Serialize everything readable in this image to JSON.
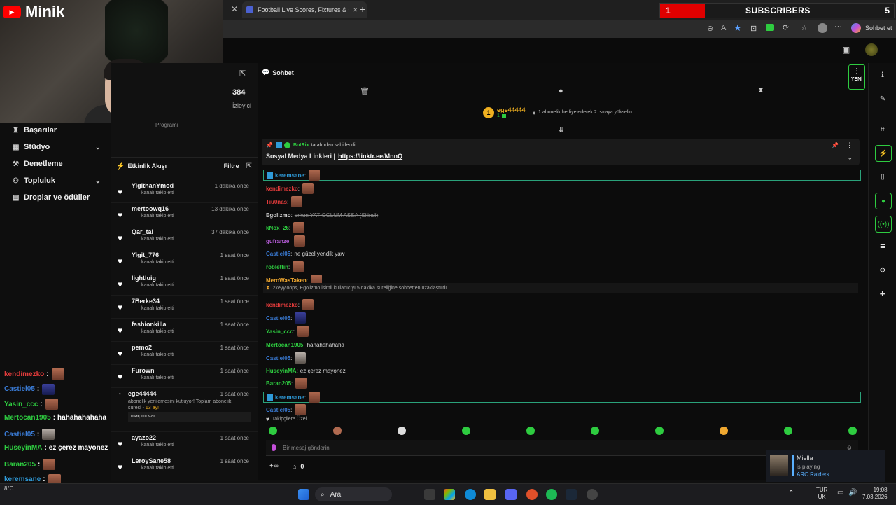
{
  "overlay_brand": "Minik",
  "browser": {
    "tab_title": "Football Live Scores, Fixtures & Od",
    "sidebar_label": "Sohbet et"
  },
  "subscribers": {
    "current": "1",
    "label": "SUBSCRIBERS",
    "goal": "5"
  },
  "leftnav": {
    "items": [
      {
        "label": "Başarılar"
      },
      {
        "label": "Stüdyo"
      },
      {
        "label": "Denetleme"
      },
      {
        "label": "Topluluk"
      },
      {
        "label": "Droplar ve ödüller"
      }
    ]
  },
  "stats": {
    "viewers": "384",
    "viewers_label": "İzleyici",
    "program_label": "Programı"
  },
  "activity": {
    "title": "Etkinlik Akışı",
    "filter": "Filtre",
    "items": [
      {
        "user": "YigithanYmod",
        "desc": "kanalı takip etti",
        "time": "1 dakika önce"
      },
      {
        "user": "mertoowq16",
        "desc": "kanalı takip etti",
        "time": "13 dakika önce"
      },
      {
        "user": "Qar_tal",
        "desc": "kanalı takip etti",
        "time": "37 dakika önce"
      },
      {
        "user": "Yigit_776",
        "desc": "kanalı takip etti",
        "time": "1 saat önce"
      },
      {
        "user": "lightluig",
        "desc": "kanalı takip etti",
        "time": "1 saat önce"
      },
      {
        "user": "7Berke34",
        "desc": "kanalı takip etti",
        "time": "1 saat önce"
      },
      {
        "user": "fashionkilla",
        "desc": "kanalı takip etti",
        "time": "1 saat önce"
      },
      {
        "user": "pemo2",
        "desc": "kanalı takip etti",
        "time": "1 saat önce"
      },
      {
        "user": "Furown",
        "desc": "kanalı takip etti",
        "time": "1 saat önce"
      }
    ],
    "sub": {
      "user": "ege44444",
      "desc": "abonelik yenilemesini kutluyor! Toplam abonelik süresi -",
      "months": "13 ay!",
      "time": "1 saat önce",
      "message": "maç mı var"
    },
    "more": [
      {
        "user": "ayazo22",
        "desc": "kanalı takip etti",
        "time": "1 saat önce"
      },
      {
        "user": "LeroySane58",
        "desc": "kanalı takip etti",
        "time": "1 saat önce"
      }
    ]
  },
  "chat": {
    "title": "Sohbet",
    "new_label": "YENİ",
    "top_gifter": {
      "rank": "1",
      "user": "ege44444",
      "count": "1",
      "text": "1 abonelik hediye ederek 2. sıraya yükselin"
    },
    "pinned": {
      "by": "BotRix",
      "by_suffix": "tarafından sabitlendi",
      "text": "Sosyal Medya Linkleri |",
      "link": "https://linktr.ee/MnnQ"
    },
    "messages": [
      {
        "user": "keremsane",
        "color": "#2f9bd9",
        "text": "",
        "emote": "red"
      },
      {
        "user": "kendimezko",
        "color": "#e23b3b",
        "text": "",
        "emote": "red"
      },
      {
        "user": "Tiu0nas",
        "color": "#e23b3b",
        "text": "",
        "emote": "red"
      },
      {
        "user": "Egolizmo",
        "color": "#cccccc",
        "text": "orkun YAT OGLUM ASSA (Silindi)",
        "emote": ""
      },
      {
        "user": "kNox_26",
        "color": "#2ecc40",
        "text": "",
        "emote": "red"
      },
      {
        "user": "gufranze",
        "color": "#b65cd8",
        "text": "",
        "emote": "red"
      },
      {
        "user": "Castiel05",
        "color": "#3a7bd5",
        "text": "ne güzel yendik yaw",
        "emote": ""
      },
      {
        "user": "roblettin",
        "color": "#2ecc40",
        "text": "",
        "emote": "red"
      },
      {
        "user": "MeroWasTaken",
        "color": "#f0a830",
        "text": "",
        "emote": "red"
      },
      {
        "user": "kendimezko",
        "color": "#e23b3b",
        "text": "",
        "emote": "red"
      },
      {
        "user": "Castiel05",
        "color": "#3a7bd5",
        "text": "",
        "emote": "blue"
      },
      {
        "user": "Yasin_ccc",
        "color": "#2ecc40",
        "text": "",
        "emote": "red"
      },
      {
        "user": "Mertocan1905",
        "color": "#2ecc40",
        "text": "hahahahahaha",
        "emote": ""
      },
      {
        "user": "Castiel05",
        "color": "#3a7bd5",
        "text": "",
        "emote": "gray"
      },
      {
        "user": "HuseyinMA",
        "color": "#2ecc40",
        "text": "ez çerez mayonez",
        "emote": ""
      },
      {
        "user": "Baran205",
        "color": "#2ecc40",
        "text": "",
        "emote": "red"
      },
      {
        "user": "keremsane",
        "color": "#2f9bd9",
        "text": "",
        "emote": "red"
      },
      {
        "user": "Castiel05",
        "color": "#3a7bd5",
        "text": "",
        "emote": "red"
      }
    ],
    "timeout_notice": "2keyyloops, Egolizmo isimli kullanıcıyı 5 dakika süreliğine sohbetten uzaklaştırdı",
    "followers_only": "Takipçilere Özel",
    "input_placeholder": "Bir mesaj gönderin",
    "points": "0"
  },
  "overlay_chat": [
    {
      "user": "kendimezko",
      "sep": ":",
      "text": "",
      "color": "#e23b3b",
      "emote": "red"
    },
    {
      "user": "Castiel05",
      "sep": ":",
      "text": "",
      "color": "#3a7bd5",
      "emote": "blue"
    },
    {
      "user": "Yasin_ccc",
      "sep": ":",
      "text": "",
      "color": "#2ecc40",
      "emote": "red"
    },
    {
      "user": "Mertocan1905",
      "sep": ":",
      "text": "hahahahahaha",
      "color": "#2ecc40",
      "emote": ""
    },
    {
      "user": "Castiel05",
      "sep": ":",
      "text": "",
      "color": "#3a7bd5",
      "emote": "gray"
    },
    {
      "user": "HuseyinMA",
      "sep": ":",
      "text": "ez çerez mayonez",
      "color": "#2ecc40",
      "emote": ""
    },
    {
      "user": "Baran205",
      "sep": ":",
      "text": "",
      "color": "#2ecc40",
      "emote": "red"
    },
    {
      "user": "keremsane",
      "sep": ":",
      "text": "",
      "color": "#2f9bd9",
      "emote": "red"
    }
  ],
  "spotify": {
    "name": "Miella",
    "status": "is playing",
    "game": "ARC Raiders"
  },
  "taskbar": {
    "search": "Ara",
    "weather": "8°C",
    "lang": "TUR",
    "region": "UK",
    "time": "19:08",
    "date": "7.03.2026"
  }
}
